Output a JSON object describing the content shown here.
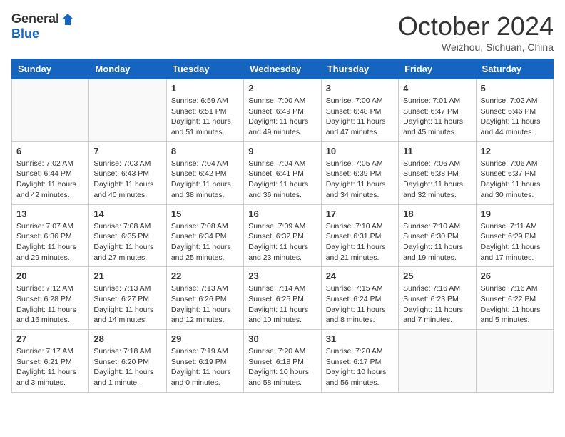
{
  "logo": {
    "general": "General",
    "blue": "Blue"
  },
  "title": "October 2024",
  "subtitle": "Weizhou, Sichuan, China",
  "days_of_week": [
    "Sunday",
    "Monday",
    "Tuesday",
    "Wednesday",
    "Thursday",
    "Friday",
    "Saturday"
  ],
  "weeks": [
    [
      {
        "day": "",
        "empty": true
      },
      {
        "day": "",
        "empty": true
      },
      {
        "day": "1",
        "sunrise": "6:59 AM",
        "sunset": "6:51 PM",
        "daylight": "11 hours and 51 minutes."
      },
      {
        "day": "2",
        "sunrise": "7:00 AM",
        "sunset": "6:49 PM",
        "daylight": "11 hours and 49 minutes."
      },
      {
        "day": "3",
        "sunrise": "7:00 AM",
        "sunset": "6:48 PM",
        "daylight": "11 hours and 47 minutes."
      },
      {
        "day": "4",
        "sunrise": "7:01 AM",
        "sunset": "6:47 PM",
        "daylight": "11 hours and 45 minutes."
      },
      {
        "day": "5",
        "sunrise": "7:02 AM",
        "sunset": "6:46 PM",
        "daylight": "11 hours and 44 minutes."
      }
    ],
    [
      {
        "day": "6",
        "sunrise": "7:02 AM",
        "sunset": "6:44 PM",
        "daylight": "11 hours and 42 minutes."
      },
      {
        "day": "7",
        "sunrise": "7:03 AM",
        "sunset": "6:43 PM",
        "daylight": "11 hours and 40 minutes."
      },
      {
        "day": "8",
        "sunrise": "7:04 AM",
        "sunset": "6:42 PM",
        "daylight": "11 hours and 38 minutes."
      },
      {
        "day": "9",
        "sunrise": "7:04 AM",
        "sunset": "6:41 PM",
        "daylight": "11 hours and 36 minutes."
      },
      {
        "day": "10",
        "sunrise": "7:05 AM",
        "sunset": "6:39 PM",
        "daylight": "11 hours and 34 minutes."
      },
      {
        "day": "11",
        "sunrise": "7:06 AM",
        "sunset": "6:38 PM",
        "daylight": "11 hours and 32 minutes."
      },
      {
        "day": "12",
        "sunrise": "7:06 AM",
        "sunset": "6:37 PM",
        "daylight": "11 hours and 30 minutes."
      }
    ],
    [
      {
        "day": "13",
        "sunrise": "7:07 AM",
        "sunset": "6:36 PM",
        "daylight": "11 hours and 29 minutes."
      },
      {
        "day": "14",
        "sunrise": "7:08 AM",
        "sunset": "6:35 PM",
        "daylight": "11 hours and 27 minutes."
      },
      {
        "day": "15",
        "sunrise": "7:08 AM",
        "sunset": "6:34 PM",
        "daylight": "11 hours and 25 minutes."
      },
      {
        "day": "16",
        "sunrise": "7:09 AM",
        "sunset": "6:32 PM",
        "daylight": "11 hours and 23 minutes."
      },
      {
        "day": "17",
        "sunrise": "7:10 AM",
        "sunset": "6:31 PM",
        "daylight": "11 hours and 21 minutes."
      },
      {
        "day": "18",
        "sunrise": "7:10 AM",
        "sunset": "6:30 PM",
        "daylight": "11 hours and 19 minutes."
      },
      {
        "day": "19",
        "sunrise": "7:11 AM",
        "sunset": "6:29 PM",
        "daylight": "11 hours and 17 minutes."
      }
    ],
    [
      {
        "day": "20",
        "sunrise": "7:12 AM",
        "sunset": "6:28 PM",
        "daylight": "11 hours and 16 minutes."
      },
      {
        "day": "21",
        "sunrise": "7:13 AM",
        "sunset": "6:27 PM",
        "daylight": "11 hours and 14 minutes."
      },
      {
        "day": "22",
        "sunrise": "7:13 AM",
        "sunset": "6:26 PM",
        "daylight": "11 hours and 12 minutes."
      },
      {
        "day": "23",
        "sunrise": "7:14 AM",
        "sunset": "6:25 PM",
        "daylight": "11 hours and 10 minutes."
      },
      {
        "day": "24",
        "sunrise": "7:15 AM",
        "sunset": "6:24 PM",
        "daylight": "11 hours and 8 minutes."
      },
      {
        "day": "25",
        "sunrise": "7:16 AM",
        "sunset": "6:23 PM",
        "daylight": "11 hours and 7 minutes."
      },
      {
        "day": "26",
        "sunrise": "7:16 AM",
        "sunset": "6:22 PM",
        "daylight": "11 hours and 5 minutes."
      }
    ],
    [
      {
        "day": "27",
        "sunrise": "7:17 AM",
        "sunset": "6:21 PM",
        "daylight": "11 hours and 3 minutes."
      },
      {
        "day": "28",
        "sunrise": "7:18 AM",
        "sunset": "6:20 PM",
        "daylight": "11 hours and 1 minute."
      },
      {
        "day": "29",
        "sunrise": "7:19 AM",
        "sunset": "6:19 PM",
        "daylight": "11 hours and 0 minutes."
      },
      {
        "day": "30",
        "sunrise": "7:20 AM",
        "sunset": "6:18 PM",
        "daylight": "10 hours and 58 minutes."
      },
      {
        "day": "31",
        "sunrise": "7:20 AM",
        "sunset": "6:17 PM",
        "daylight": "10 hours and 56 minutes."
      },
      {
        "day": "",
        "empty": true
      },
      {
        "day": "",
        "empty": true
      }
    ]
  ]
}
